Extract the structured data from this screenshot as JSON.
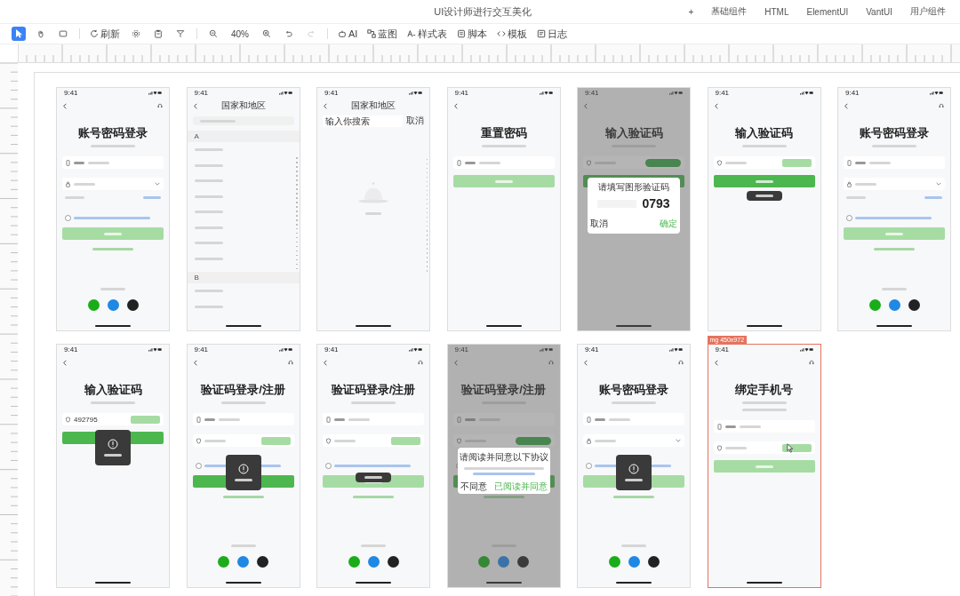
{
  "window": {
    "title": "UI设计师进行交互美化"
  },
  "tabs": [
    "+",
    "基础组件",
    "HTML",
    "ElementUI",
    "VantUI",
    "用户组件"
  ],
  "toolbar": [
    {
      "kind": "tool",
      "selected": true,
      "disabled": false
    },
    {
      "kind": "tool",
      "selected": false,
      "disabled": false
    },
    {
      "kind": "tool",
      "selected": false,
      "disabled": false
    },
    {
      "kind": "sep"
    },
    {
      "kind": "labeled",
      "label": "刷新"
    },
    {
      "kind": "tool",
      "selected": false,
      "disabled": false
    },
    {
      "kind": "tool",
      "selected": false,
      "disabled": false
    },
    {
      "kind": "tool",
      "selected": false,
      "disabled": false
    },
    {
      "kind": "sep"
    },
    {
      "kind": "tool",
      "selected": false,
      "disabled": false
    },
    {
      "kind": "text",
      "label": "40%"
    },
    {
      "kind": "tool",
      "selected": false,
      "disabled": false
    },
    {
      "kind": "tool",
      "selected": false,
      "disabled": false
    },
    {
      "kind": "tool",
      "selected": false,
      "disabled": true
    },
    {
      "kind": "sep"
    },
    {
      "kind": "labeled",
      "label": "AI"
    },
    {
      "kind": "labeled",
      "label": "蓝图"
    },
    {
      "kind": "labeled",
      "label": "样式表"
    },
    {
      "kind": "labeled",
      "label": "脚本"
    },
    {
      "kind": "labeled",
      "label": "模板"
    },
    {
      "kind": "labeled",
      "label": "日志"
    }
  ],
  "canvas": {
    "rows": [
      {
        "screens": [
          {
            "time": "9:41",
            "help": true,
            "dimmed": false,
            "selected": false,
            "items": [
              {
                "kind": "heading",
                "text": "账号密码登录"
              },
              {
                "kind": "subtitle"
              },
              {
                "kind": "phone-field"
              },
              {
                "kind": "password-field"
              },
              {
                "kind": "remember"
              },
              {
                "kind": "agreement"
              },
              {
                "kind": "button",
                "active": false
              },
              {
                "kind": "link"
              },
              {
                "kind": "social"
              }
            ]
          },
          {
            "time": "9:41",
            "help": false,
            "dimmed": false,
            "selected": false,
            "nav_title": "国家和地区",
            "items": [
              {
                "kind": "search-bar"
              },
              {
                "kind": "index-bar"
              },
              {
                "kind": "list-header",
                "text": "A"
              },
              {
                "kind": "list-row"
              },
              {
                "kind": "list-row"
              },
              {
                "kind": "list-row"
              },
              {
                "kind": "list-row"
              },
              {
                "kind": "list-row"
              },
              {
                "kind": "list-row"
              },
              {
                "kind": "list-row"
              },
              {
                "kind": "list-row"
              },
              {
                "kind": "list-header",
                "text": "B"
              },
              {
                "kind": "list-row"
              },
              {
                "kind": "list-row"
              }
            ]
          },
          {
            "time": "9:41",
            "help": false,
            "dimmed": false,
            "selected": false,
            "nav_title": "国家和地区",
            "items": [
              {
                "kind": "search",
                "value": "输入你搜索",
                "action": "取消"
              },
              {
                "kind": "index-bar"
              },
              {
                "kind": "empty"
              }
            ]
          },
          {
            "time": "9:41",
            "help": false,
            "dimmed": false,
            "selected": false,
            "items": [
              {
                "kind": "heading",
                "text": "重置密码"
              },
              {
                "kind": "subtitle"
              },
              {
                "kind": "phone-field"
              },
              {
                "kind": "button",
                "active": false
              }
            ]
          },
          {
            "time": "9:41",
            "help": false,
            "dimmed": true,
            "selected": false,
            "items": [
              {
                "kind": "heading",
                "text": "输入验证码"
              },
              {
                "kind": "subtitle"
              },
              {
                "kind": "code-field",
                "code_sent": true
              },
              {
                "kind": "dialog",
                "title": "请填写图形验证码",
                "code": "0793",
                "buttons": [
                  "取消",
                  "确定"
                ]
              },
              {
                "kind": "button",
                "active": true
              }
            ]
          },
          {
            "time": "9:41",
            "help": false,
            "dimmed": false,
            "selected": false,
            "items": [
              {
                "kind": "heading",
                "text": "输入验证码"
              },
              {
                "kind": "subtitle"
              },
              {
                "kind": "code-field",
                "code_sent": false
              },
              {
                "kind": "button",
                "active": true
              },
              {
                "kind": "toast",
                "icon": false
              }
            ]
          },
          {
            "time": "9:41",
            "help": true,
            "dimmed": false,
            "selected": false,
            "items": [
              {
                "kind": "heading",
                "text": "账号密码登录"
              },
              {
                "kind": "subtitle"
              },
              {
                "kind": "phone-field"
              },
              {
                "kind": "password-field"
              },
              {
                "kind": "remember"
              },
              {
                "kind": "agreement"
              },
              {
                "kind": "button",
                "active": false
              },
              {
                "kind": "link"
              },
              {
                "kind": "social"
              }
            ]
          }
        ]
      },
      {
        "screens": [
          {
            "time": "9:41",
            "help": false,
            "dimmed": false,
            "selected": false,
            "items": [
              {
                "kind": "heading",
                "text": "输入验证码"
              },
              {
                "kind": "subtitle"
              },
              {
                "kind": "code-field",
                "value": "492795",
                "code_sent": false
              },
              {
                "kind": "button",
                "active": true
              },
              {
                "kind": "toast",
                "icon": true
              }
            ]
          },
          {
            "time": "9:41",
            "help": true,
            "dimmed": false,
            "selected": false,
            "items": [
              {
                "kind": "heading",
                "text": "验证码登录/注册"
              },
              {
                "kind": "subtitle"
              },
              {
                "kind": "phone-field"
              },
              {
                "kind": "code-field",
                "code_sent": false
              },
              {
                "kind": "agreement"
              },
              {
                "kind": "toast",
                "icon": true
              },
              {
                "kind": "button",
                "active": true
              },
              {
                "kind": "link"
              },
              {
                "kind": "social"
              }
            ]
          },
          {
            "time": "9:41",
            "help": true,
            "dimmed": false,
            "selected": false,
            "items": [
              {
                "kind": "heading",
                "text": "验证码登录/注册"
              },
              {
                "kind": "subtitle"
              },
              {
                "kind": "phone-field"
              },
              {
                "kind": "code-field",
                "code_sent": false
              },
              {
                "kind": "agreement"
              },
              {
                "kind": "toast",
                "icon": false
              },
              {
                "kind": "button",
                "active": false
              },
              {
                "kind": "link"
              },
              {
                "kind": "social"
              }
            ]
          },
          {
            "time": "9:41",
            "help": true,
            "dimmed": true,
            "selected": false,
            "items": [
              {
                "kind": "heading",
                "text": "验证码登录/注册"
              },
              {
                "kind": "subtitle"
              },
              {
                "kind": "phone-field"
              },
              {
                "kind": "code-field",
                "code_sent": true
              },
              {
                "kind": "dialog",
                "title": "请阅读并同意以下协议",
                "buttons": [
                  "不同意",
                  "已阅读并同意"
                ]
              },
              {
                "kind": "agreement"
              },
              {
                "kind": "button",
                "active": true
              },
              {
                "kind": "link"
              },
              {
                "kind": "social"
              }
            ]
          },
          {
            "time": "9:41",
            "help": true,
            "dimmed": false,
            "selected": false,
            "items": [
              {
                "kind": "heading",
                "text": "账号密码登录"
              },
              {
                "kind": "subtitle"
              },
              {
                "kind": "phone-field"
              },
              {
                "kind": "password-field"
              },
              {
                "kind": "agreement"
              },
              {
                "kind": "toast",
                "icon": true
              },
              {
                "kind": "button",
                "active": false
              },
              {
                "kind": "link"
              },
              {
                "kind": "social"
              }
            ]
          },
          {
            "time": "9:41",
            "help": true,
            "dimmed": false,
            "selected": true,
            "size_label": "mg 450x972",
            "items": [
              {
                "kind": "heading",
                "text": "绑定手机号"
              },
              {
                "kind": "subtitle"
              },
              {
                "kind": "subtitle"
              },
              {
                "kind": "phone-field"
              },
              {
                "kind": "code-field",
                "code_sent": false
              },
              {
                "kind": "pointer"
              },
              {
                "kind": "button",
                "active": false
              }
            ]
          }
        ]
      }
    ]
  }
}
